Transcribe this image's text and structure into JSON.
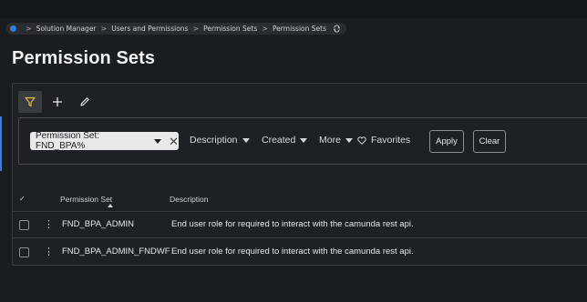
{
  "breadcrumb": {
    "items": [
      "Solution Manager",
      "Users and Permissions",
      "Permission Sets",
      "Permission Sets"
    ],
    "separator": ">",
    "icons": [
      "app-dot-icon",
      "refresh-icon"
    ]
  },
  "page": {
    "title": "Permission Sets"
  },
  "toolbar": {
    "icons": [
      "filter-icon",
      "plus-icon",
      "pencil-icon"
    ]
  },
  "filters": {
    "active_chip": "Permission Set: FND_BPA%",
    "dropdowns": [
      "Description",
      "Created",
      "More"
    ],
    "favorites_label": "Favorites",
    "apply_label": "Apply",
    "clear_label": "Clear"
  },
  "table": {
    "columns": [
      "Permission Set",
      "Description"
    ],
    "header_check": "✓",
    "rows": [
      {
        "name": "FND_BPA_ADMIN",
        "description": "End user role for required to interact with the camunda rest api."
      },
      {
        "name": "FND_BPA_ADMIN_FNDWF",
        "description": "End user role for required to interact with the camunda rest api."
      }
    ]
  },
  "colors": {
    "accent": "#2f7fe0",
    "background": "#1b1c1e",
    "filter_icon": "#e2b93b"
  }
}
